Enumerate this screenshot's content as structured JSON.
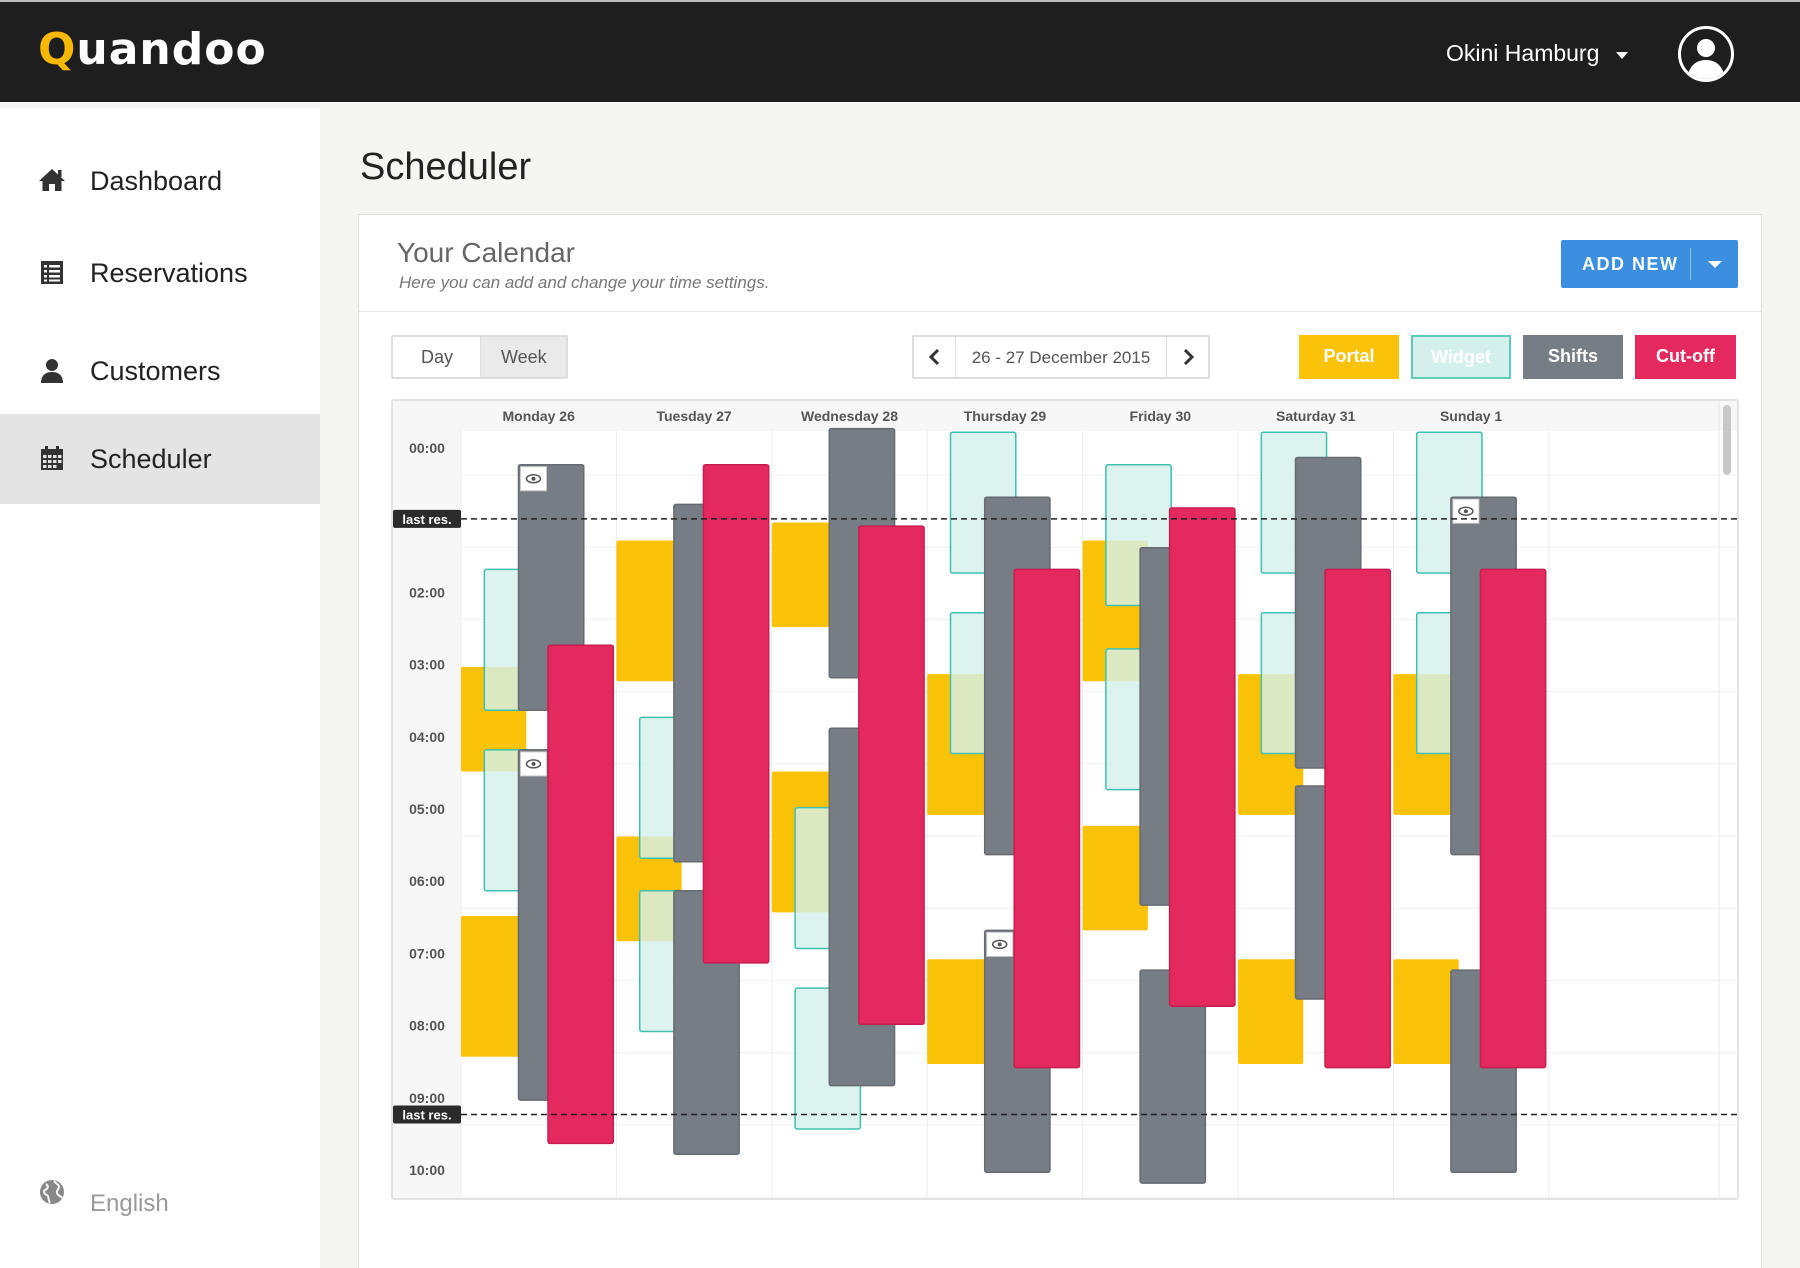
{
  "app": {
    "logo_q": "Q",
    "logo_rest": "uandoo"
  },
  "header": {
    "user_name": "Okini Hamburg",
    "avatar_icon": "user-avatar-icon"
  },
  "sidebar": {
    "items": [
      {
        "label": "Dashboard",
        "icon": "home-icon"
      },
      {
        "label": "Reservations",
        "icon": "list-icon"
      },
      {
        "label": "Customers",
        "icon": "user-icon"
      },
      {
        "label": "Scheduler",
        "icon": "calendar-icon",
        "active": true
      }
    ],
    "language": {
      "label": "English",
      "icon": "globe-icon"
    }
  },
  "page": {
    "title": "Scheduler"
  },
  "calendar_card": {
    "title": "Your Calendar",
    "subtitle": "Here you can add and change your  time settings.",
    "add_new_label": "ADD NEW"
  },
  "view_toggle": {
    "day": "Day",
    "week": "Week",
    "selected": "Week"
  },
  "date_nav": {
    "label": "26 - 27 December 2015"
  },
  "legend": {
    "portal": {
      "label": "Portal",
      "color": "#fbc20a"
    },
    "widget": {
      "label": "Widget",
      "color": "#d4f0ec"
    },
    "shifts": {
      "label": "Shifts",
      "color": "#777d85"
    },
    "cutoff": {
      "label": "Cut-off",
      "color": "#e4295f"
    }
  },
  "schedule": {
    "days": [
      "Monday 26",
      "Tuesday 27",
      "Wednesday 28",
      "Thursday 29",
      "Friday 30",
      "Saturday 31",
      "Sunday 1"
    ],
    "hours": [
      "00:00",
      "01:00",
      "02:00",
      "03:00",
      "04:00",
      "05:00",
      "06:00",
      "07:00",
      "08:00",
      "09:00",
      "10:00"
    ],
    "last_res_label": "last res.",
    "last_res_times": [
      1.3,
      9.55
    ],
    "blocks": [
      {
        "day": 0,
        "type": "portal",
        "start": 3.35,
        "end": 4.8
      },
      {
        "day": 0,
        "type": "portal",
        "start": 6.8,
        "end": 8.75
      },
      {
        "day": 0,
        "type": "widget",
        "start": 2.0,
        "end": 3.95
      },
      {
        "day": 0,
        "type": "widget",
        "start": 4.5,
        "end": 6.45
      },
      {
        "day": 0,
        "type": "shifts",
        "start": 0.55,
        "end": 3.95,
        "eye": true
      },
      {
        "day": 0,
        "type": "shifts",
        "start": 4.5,
        "end": 9.35,
        "eye": true
      },
      {
        "day": 0,
        "type": "cutoff",
        "start": 3.05,
        "end": 9.95
      },
      {
        "day": 1,
        "type": "portal",
        "start": 1.6,
        "end": 3.55
      },
      {
        "day": 1,
        "type": "portal",
        "start": 5.7,
        "end": 7.15
      },
      {
        "day": 1,
        "type": "widget",
        "start": 4.05,
        "end": 6.0
      },
      {
        "day": 1,
        "type": "widget",
        "start": 6.45,
        "end": 8.4
      },
      {
        "day": 1,
        "type": "shifts",
        "start": 1.1,
        "end": 6.05
      },
      {
        "day": 1,
        "type": "shifts",
        "start": 6.45,
        "end": 10.1
      },
      {
        "day": 1,
        "type": "cutoff",
        "start": 0.55,
        "end": 7.45
      },
      {
        "day": 2,
        "type": "portal",
        "start": 1.35,
        "end": 2.8
      },
      {
        "day": 2,
        "type": "portal",
        "start": 4.8,
        "end": 6.75
      },
      {
        "day": 2,
        "type": "widget",
        "start": 5.3,
        "end": 7.25
      },
      {
        "day": 2,
        "type": "widget",
        "start": 7.8,
        "end": 9.75
      },
      {
        "day": 2,
        "type": "shifts",
        "start": 0.05,
        "end": 3.5
      },
      {
        "day": 2,
        "type": "shifts",
        "start": 4.2,
        "end": 9.15
      },
      {
        "day": 2,
        "type": "cutoff",
        "start": 1.4,
        "end": 8.3
      },
      {
        "day": 3,
        "type": "portal",
        "start": 3.45,
        "end": 5.4
      },
      {
        "day": 3,
        "type": "portal",
        "start": 7.4,
        "end": 8.85
      },
      {
        "day": 3,
        "type": "widget",
        "start": 0.1,
        "end": 2.05
      },
      {
        "day": 3,
        "type": "widget",
        "start": 2.6,
        "end": 4.55
      },
      {
        "day": 3,
        "type": "shifts",
        "start": 1.0,
        "end": 5.95
      },
      {
        "day": 3,
        "type": "shifts",
        "start": 7.0,
        "end": 10.35,
        "eye": true
      },
      {
        "day": 3,
        "type": "cutoff",
        "start": 2.0,
        "end": 8.9
      },
      {
        "day": 4,
        "type": "portal",
        "start": 1.6,
        "end": 3.55
      },
      {
        "day": 4,
        "type": "portal",
        "start": 5.55,
        "end": 7.0
      },
      {
        "day": 4,
        "type": "widget",
        "start": 0.55,
        "end": 2.5
      },
      {
        "day": 4,
        "type": "widget",
        "start": 3.1,
        "end": 5.05
      },
      {
        "day": 4,
        "type": "shifts",
        "start": 1.7,
        "end": 6.65
      },
      {
        "day": 4,
        "type": "shifts",
        "start": 7.55,
        "end": 10.5
      },
      {
        "day": 4,
        "type": "cutoff",
        "start": 1.15,
        "end": 8.05
      },
      {
        "day": 5,
        "type": "portal",
        "start": 3.45,
        "end": 5.4
      },
      {
        "day": 5,
        "type": "portal",
        "start": 7.4,
        "end": 8.85
      },
      {
        "day": 5,
        "type": "widget",
        "start": 0.1,
        "end": 2.05
      },
      {
        "day": 5,
        "type": "widget",
        "start": 2.6,
        "end": 4.55
      },
      {
        "day": 5,
        "type": "shifts",
        "start": 0.45,
        "end": 4.75
      },
      {
        "day": 5,
        "type": "shifts",
        "start": 5.0,
        "end": 7.95
      },
      {
        "day": 5,
        "type": "cutoff",
        "start": 2.0,
        "end": 8.9
      },
      {
        "day": 6,
        "type": "portal",
        "start": 3.45,
        "end": 5.4
      },
      {
        "day": 6,
        "type": "portal",
        "start": 7.4,
        "end": 8.85
      },
      {
        "day": 6,
        "type": "widget",
        "start": 0.1,
        "end": 2.05
      },
      {
        "day": 6,
        "type": "widget",
        "start": 2.6,
        "end": 4.55
      },
      {
        "day": 6,
        "type": "shifts",
        "start": 1.0,
        "end": 5.95,
        "eye": true
      },
      {
        "day": 6,
        "type": "shifts",
        "start": 7.55,
        "end": 10.35
      },
      {
        "day": 6,
        "type": "cutoff",
        "start": 2.0,
        "end": 8.9
      }
    ]
  }
}
